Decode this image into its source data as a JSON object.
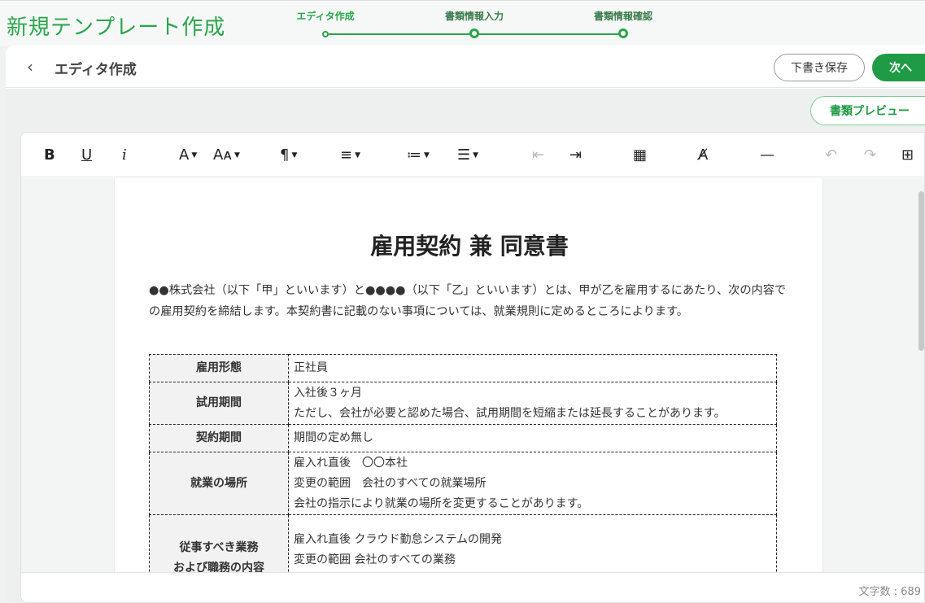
{
  "header": {
    "app_title": "新規テンプレート作成",
    "steps": [
      {
        "label": "エディタ作成"
      },
      {
        "label": "書類情報入力"
      },
      {
        "label": "書類情報確認"
      }
    ]
  },
  "subheader": {
    "back": "‹",
    "title": "エディタ作成",
    "draft_button": "下書き保存",
    "next_button": "次へ"
  },
  "preview_button": "書類プレビュー",
  "toolbar": {
    "bold": "B",
    "underline": "U",
    "italic": "i",
    "font_color": "A",
    "font_size": "Aᴀ",
    "paragraph": "¶",
    "align": "≡",
    "ordered_list": "≔",
    "bullet_list": "☰",
    "outdent": "⇤",
    "indent": "⇥",
    "table": "▦",
    "clear_format": "A̸",
    "horizontal_rule": "—",
    "undo": "↶",
    "redo": "↷",
    "select_all": "⊞"
  },
  "document": {
    "title": "雇用契約 兼 同意書",
    "intro": "●●株式会社（以下「甲」といいます）と●●●●（以下「乙」といいます）とは、甲が乙を雇用するにあたり、次の内容での雇用契約を締結します。本契約書に記載のない事項については、就業規則に定めるところによります。",
    "rows": [
      {
        "label": "雇用形態",
        "lines": [
          "正社員"
        ]
      },
      {
        "label": "試用期間",
        "lines": [
          "入社後３ヶ月",
          "ただし、会社が必要と認めた場合、試用期間を短縮または延長することがあります。"
        ]
      },
      {
        "label": "契約期間",
        "lines": [
          "期間の定め無し"
        ]
      },
      {
        "label": "就業の場所",
        "lines": [
          "雇入れ直後　〇〇本社",
          "変更の範囲　会社のすべての就業場所",
          "会社の指示により就業の場所を変更することがあります。"
        ]
      },
      {
        "label": "従事すべき業務\nおよび職務の内容",
        "lines": [
          "雇入れ直後 クラウド勤怠システムの開発",
          "変更の範囲 会社のすべての業務"
        ]
      }
    ]
  },
  "footer": {
    "char_count": "文字数 : 689"
  },
  "colors": {
    "accent": "#1f9a45",
    "title_green": "#2aa54a"
  }
}
